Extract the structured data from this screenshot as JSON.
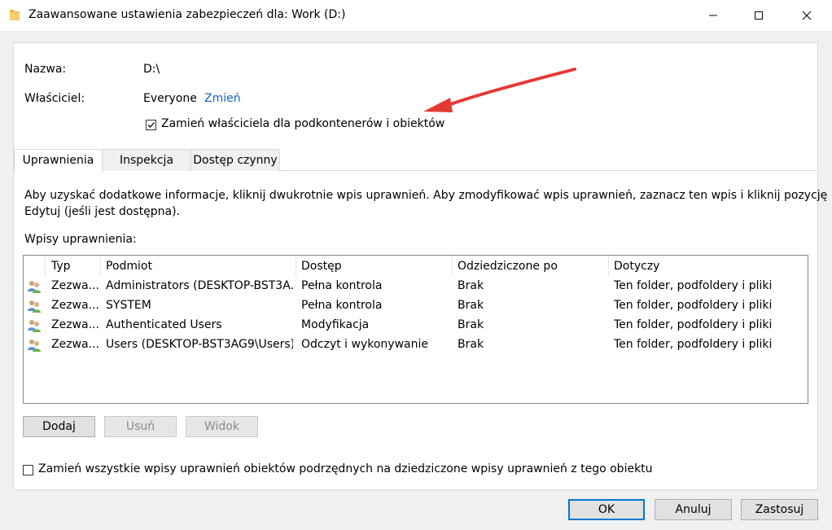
{
  "window": {
    "title": "Zaawansowane ustawienia zabezpieczeń dla: Work (D:)"
  },
  "info": {
    "name_label": "Nazwa:",
    "name_value": "D:\\",
    "owner_label": "Właściciel:",
    "owner_value": "Everyone",
    "change_link": "Zmień",
    "replace_owner_label": "Zamień właściciela dla podkontenerów i obiektów",
    "replace_owner_checked": true
  },
  "tabs": [
    {
      "label": "Uprawnienia",
      "active": true
    },
    {
      "label": "Inspekcja",
      "active": false
    },
    {
      "label": "Dostęp czynny",
      "active": false
    }
  ],
  "permissions": {
    "help_line1": "Aby uzyskać dodatkowe informacje, kliknij dwukrotnie wpis uprawnień. Aby zmodyfikować wpis uprawnień, zaznacz ten wpis i kliknij pozycję",
    "help_line2": "Edytuj (jeśli jest dostępna).",
    "entries_label": "Wpisy uprawnienia:",
    "columns": [
      "Typ",
      "Podmiot",
      "Dostęp",
      "Odziedziczone po",
      "Dotyczy"
    ],
    "rows": [
      {
        "type": "Zezwa...",
        "principal": "Administrators (DESKTOP-BST3A...",
        "access": "Pełna kontrola",
        "inherited": "Brak",
        "applies": "Ten folder, podfoldery i pliki"
      },
      {
        "type": "Zezwa...",
        "principal": "SYSTEM",
        "access": "Pełna kontrola",
        "inherited": "Brak",
        "applies": "Ten folder, podfoldery i pliki"
      },
      {
        "type": "Zezwa...",
        "principal": "Authenticated Users",
        "access": "Modyfikacja",
        "inherited": "Brak",
        "applies": "Ten folder, podfoldery i pliki"
      },
      {
        "type": "Zezwa...",
        "principal": "Users (DESKTOP-BST3AG9\\Users)",
        "access": "Odczyt i wykonywanie",
        "inherited": "Brak",
        "applies": "Ten folder, podfoldery i pliki"
      }
    ],
    "add_button": "Dodaj",
    "remove_button": "Usuń",
    "view_button": "Widok",
    "replace_all_label": "Zamień wszystkie wpisy uprawnień obiektów podrzędnych na dziedziczone wpisy uprawnień z tego obiektu",
    "replace_all_checked": false
  },
  "footer": {
    "ok_button": "OK",
    "cancel_button": "Anuluj",
    "apply_button": "Zastosuj"
  },
  "colors": {
    "link": "#1565c0",
    "annotation_arrow": "#e53935",
    "default_button_border": "#0078d7"
  },
  "icons": [
    "folder-icon",
    "minimize-icon",
    "maximize-icon",
    "close-icon",
    "checkmark-icon",
    "user-group-icon",
    "annotation-arrow"
  ]
}
